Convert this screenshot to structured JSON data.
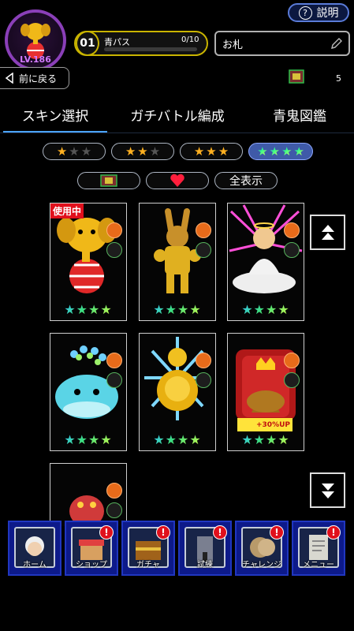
{
  "header": {
    "level": "LV.186",
    "help_label": "説明",
    "pass": {
      "number": "01",
      "label": "青パス",
      "count": "0/10",
      "progress": 0
    },
    "name_value": "お札",
    "back_label": "前に戻る",
    "ticket_count": "5"
  },
  "tabs": [
    {
      "label": "スキン選択",
      "active": true
    },
    {
      "label": "ガチバトル編成",
      "active": false
    },
    {
      "label": "青鬼図鑑",
      "active": false
    }
  ],
  "rarity_filters": [
    {
      "stars": 3,
      "filled": 1,
      "style": "gold",
      "active": false
    },
    {
      "stars": 3,
      "filled": 2,
      "style": "gold",
      "active": false
    },
    {
      "stars": 3,
      "filled": 3,
      "style": "gold",
      "active": false
    },
    {
      "stars": 4,
      "filled": 4,
      "style": "rainbow",
      "active": true
    }
  ],
  "type_filters": {
    "show_all_label": "全表示"
  },
  "cards": [
    {
      "name": "elephant-skin",
      "in_use_label": "使用中",
      "stars": 4
    },
    {
      "name": "kangaroo-skin",
      "stars": 4
    },
    {
      "name": "god-skin",
      "stars": 4
    },
    {
      "name": "whale-skin",
      "stars": 4
    },
    {
      "name": "lion-skin",
      "stars": 4
    },
    {
      "name": "poop-king-skin",
      "stars": 4,
      "boost_label": "+30%UP"
    },
    {
      "name": "red-oni-skin",
      "stars": 4
    }
  ],
  "bottom_nav": [
    {
      "label": "ホーム",
      "alert": false
    },
    {
      "label": "ショップ",
      "alert": true
    },
    {
      "label": "ガチャ",
      "alert": true
    },
    {
      "label": "試練",
      "alert": true
    },
    {
      "label": "チャレンジ",
      "alert": true
    },
    {
      "label": "メニュー",
      "alert": true
    }
  ],
  "alert_mark": "!",
  "colors": {
    "accent": "#4aa3ff",
    "pass_gold": "#c9b400",
    "nav_blue": "#0d1a8a",
    "alert_red": "#e0101c"
  }
}
